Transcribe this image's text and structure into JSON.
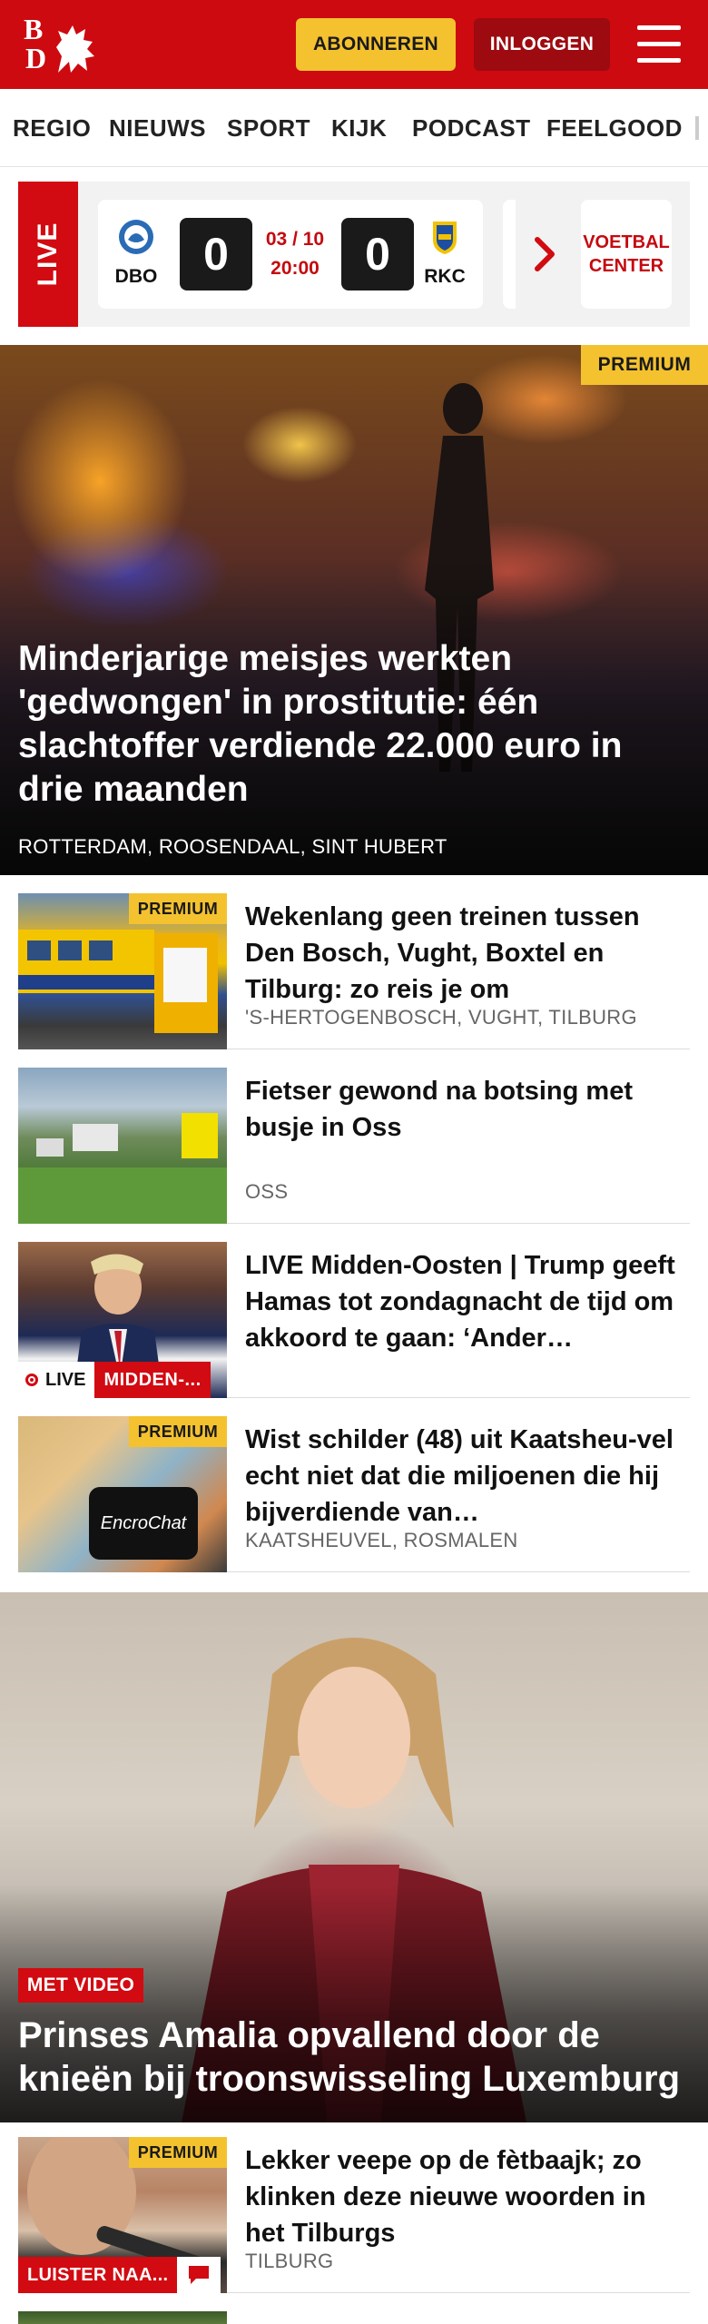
{
  "header": {
    "logo_top": "B",
    "logo_bottom": "D",
    "subscribe_label": "ABONNEREN",
    "login_label": "INLOGGEN"
  },
  "nav": {
    "items": [
      "REGIO",
      "NIEUWS",
      "SPORT",
      "KIJK",
      "PODCAST",
      "FEELGOOD"
    ]
  },
  "live_widget": {
    "tab_label": "LIVE",
    "home_team": "DBO",
    "away_team": "RKC",
    "home_score": "0",
    "away_score": "0",
    "date": "03 / 10",
    "time": "20:00",
    "center_label_1": "VOETBAL",
    "center_label_2": "CENTER"
  },
  "hero": {
    "badge": "PREMIUM",
    "title": "Minderjarige meisjes werkten 'gedwongen' in prostitutie: één slachtoffer verdiende 22.000 euro in drie maanden",
    "location": "ROTTERDAM, ROOSENDAAL, SINT HUBERT"
  },
  "articles": [
    {
      "badge": "PREMIUM",
      "title": "Wekenlang geen treinen tussen Den Bosch, Vught, Boxtel en Tilburg: zo reis je om",
      "location": "'S-HERTOGENBOSCH, VUGHT, TILBURG"
    },
    {
      "title": "Fietser gewond na botsing met busje in Oss",
      "location": "OSS"
    },
    {
      "live_label": "LIVE",
      "category": "MIDDEN-...",
      "title": "LIVE Midden-Oosten | Trump geeft Hamas tot zondagnacht de tijd om akkoord te gaan: ‘Ander…"
    },
    {
      "badge": "PREMIUM",
      "thumb_text": "EncroChat",
      "title": "Wist schilder (48) uit Kaatsheu-vel echt niet dat die miljoenen die hij bijverdiende van…",
      "location": "KAATSHEUVEL, ROSMALEN"
    }
  ],
  "hero2": {
    "badge": "MET VIDEO",
    "title": "Prinses Amalia opvallend door de knieën bij troonswisseling Luxemburg"
  },
  "article_bottom": {
    "badge": "PREMIUM",
    "listen_label": "LUISTER NAA...",
    "title": "Lekker veepe op de fètbaajk; zo klinken deze nieuwe woorden in het Tilburgs",
    "location": "TILBURG"
  },
  "colors": {
    "brand_red": "#cc0a10",
    "premium_yellow": "#f4c22f",
    "login_dark_red": "#9d0a10"
  }
}
